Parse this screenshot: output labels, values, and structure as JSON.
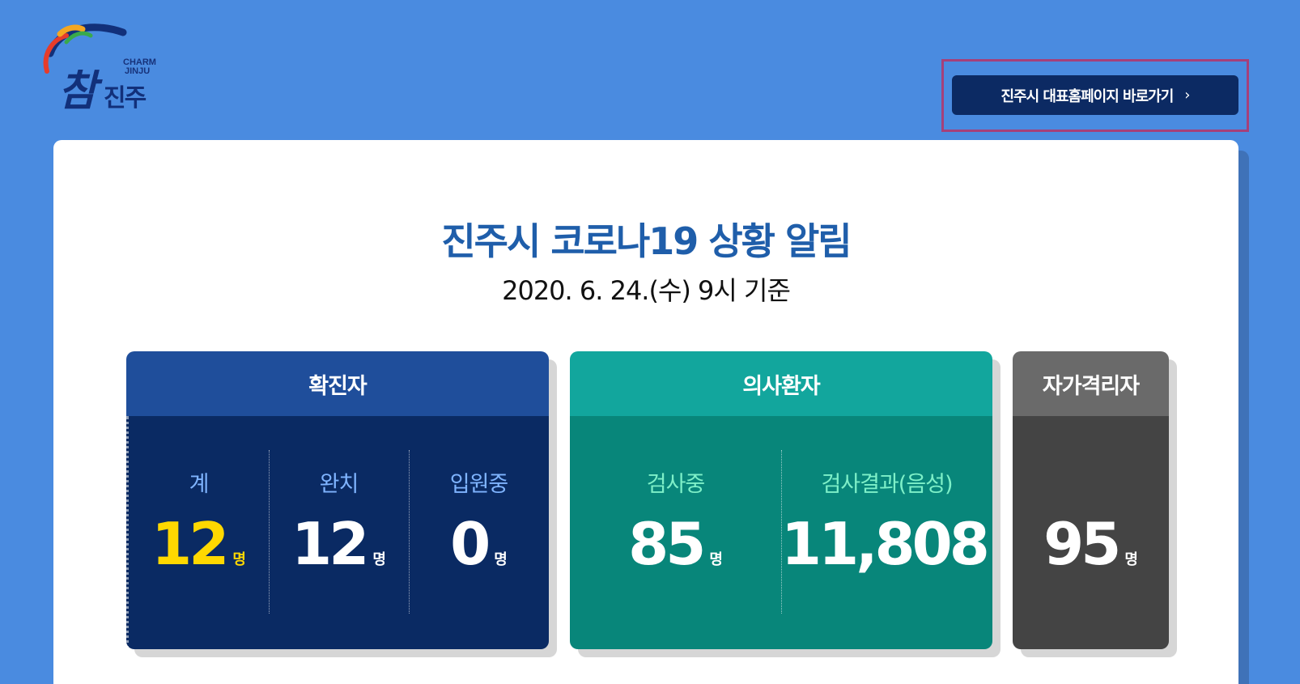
{
  "logo": {
    "english_line1": "CHARM",
    "english_line2": "JINJU",
    "korean_part1": "참",
    "korean_part2": "진주"
  },
  "header": {
    "home_button_label": "진주시 대표홈페이지 바로가기",
    "home_button_icon": "chevron-right-icon"
  },
  "colors": {
    "background": "#4a8be0",
    "confirmed_head": "#1f4e9b",
    "confirmed_body": "#0a2a63",
    "suspected_head": "#12a69d",
    "suspected_body": "#08867a",
    "quarantine_head": "#6a6a6a",
    "quarantine_body": "#444444",
    "highlight": "#ffd800",
    "annotation": "#a5407a"
  },
  "main": {
    "title": "진주시 코로나19 상황 알림",
    "subtitle": "2020. 6. 24.(수) 9시 기준"
  },
  "stats": {
    "confirmed": {
      "heading": "확진자",
      "items": [
        {
          "label": "계",
          "value": "12",
          "unit": "명"
        },
        {
          "label": "완치",
          "value": "12",
          "unit": "명"
        },
        {
          "label": "입원중",
          "value": "0",
          "unit": "명"
        }
      ]
    },
    "suspected": {
      "heading": "의사환자",
      "items": [
        {
          "label": "검사중",
          "value": "85",
          "unit": "명"
        },
        {
          "label": "검사결과(음성)",
          "value": "11,808",
          "unit": "명"
        }
      ]
    },
    "quarantine": {
      "heading": "자가격리자",
      "items": [
        {
          "value": "95",
          "unit": "명"
        }
      ]
    }
  }
}
